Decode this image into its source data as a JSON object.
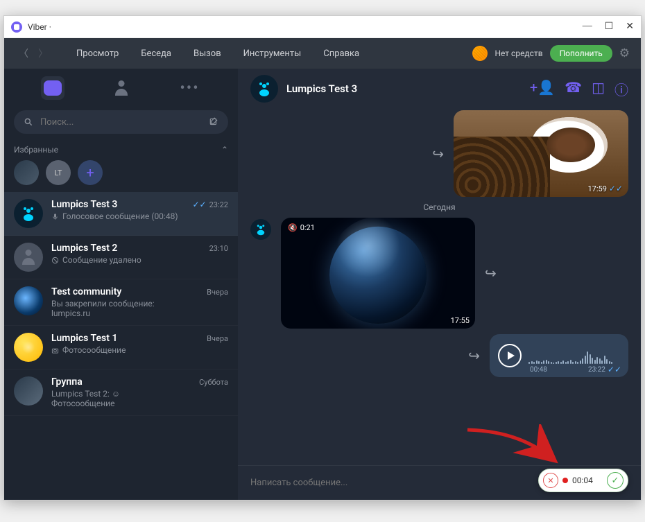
{
  "window": {
    "title": "Viber · "
  },
  "menubar": {
    "items": [
      "Просмотр",
      "Беседа",
      "Вызов",
      "Инструменты",
      "Справка"
    ],
    "funds": "Нет средств",
    "refill": "Пополнить"
  },
  "search": {
    "placeholder": "Поиск..."
  },
  "favorites": {
    "title": "Избранные",
    "lt": "LT"
  },
  "chat_list": [
    {
      "name": "Lumpics Test 3",
      "preview": "Голосовое сообщение (00:48)",
      "time": "23:22",
      "checks": true,
      "icon": "mic",
      "avatar": "cyan"
    },
    {
      "name": "Lumpics Test 2",
      "preview": "Сообщение удалено",
      "time": "23:10",
      "icon": "del",
      "avatar": "gray"
    },
    {
      "name": "Test community",
      "preview": "Вы закрепили сообщение:",
      "preview2": "lumpics.ru",
      "time": "Вчера",
      "avatar": "space"
    },
    {
      "name": "Lumpics Test 1",
      "preview": "Фотосообщение",
      "time": "Вчера",
      "icon": "photo",
      "avatar": "lemon"
    },
    {
      "name": "Группа",
      "preview": "Lumpics Test 2: ☺",
      "preview2": "Фотосообщение",
      "time": "Суббота",
      "avatar": "tech"
    }
  ],
  "conversation": {
    "title": "Lumpics Test 3",
    "coffee_time": "17:59",
    "day_separator": "Сегодня",
    "earth_duration": "0:21",
    "earth_time": "17:55",
    "voice": {
      "duration": "00:48",
      "time": "23:22"
    },
    "compose_placeholder": "Написать сообщение...",
    "recording": {
      "time": "00:04"
    }
  }
}
